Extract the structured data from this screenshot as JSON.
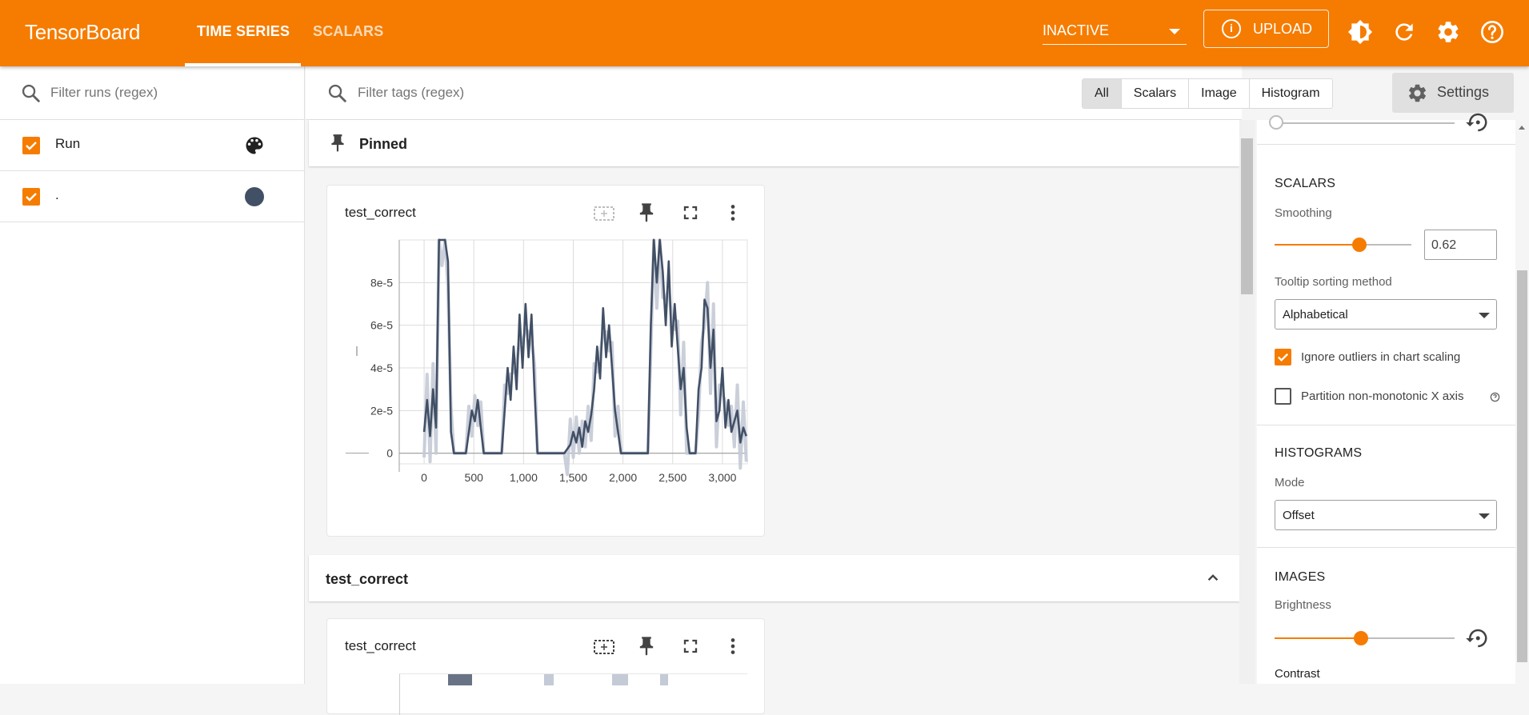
{
  "app": {
    "title": "TensorBoard",
    "nav_tabs": [
      "TIME SERIES",
      "SCALARS"
    ],
    "status": "INACTIVE",
    "upload_label": "UPLOAD",
    "brand_color": "#f57c00"
  },
  "runs": {
    "filter_placeholder": "Filter runs (regex)",
    "items": [
      {
        "name": "Run",
        "checked": true,
        "icon": "palette-icon"
      },
      {
        "name": ".",
        "checked": true,
        "color": "#425066"
      }
    ]
  },
  "main": {
    "tag_filter_placeholder": "Filter tags (regex)",
    "type_filters": [
      "All",
      "Scalars",
      "Image",
      "Histogram"
    ],
    "selected_filter": "All",
    "settings_label": "Settings",
    "pinned_label": "Pinned",
    "group_label": "test_correct",
    "cards": [
      {
        "title": "test_correct"
      },
      {
        "title": "test_correct"
      }
    ]
  },
  "settings": {
    "scalars_title": "SCALARS",
    "smoothing_label": "Smoothing",
    "smoothing_value": "0.62",
    "tooltip_label": "Tooltip sorting method",
    "tooltip_value": "Alphabetical",
    "ignore_outliers_label": "Ignore outliers in chart scaling",
    "ignore_outliers": true,
    "partition_label": "Partition non-monotonic X axis",
    "partition": false,
    "histograms_title": "HISTOGRAMS",
    "mode_label": "Mode",
    "mode_value": "Offset",
    "images_title": "IMAGES",
    "brightness_label": "Brightness",
    "contrast_label": "Contrast"
  },
  "chart_data": {
    "type": "line",
    "title": "test_correct",
    "y_tick_labels": [
      "0",
      "2e-5",
      "4e-5",
      "6e-5",
      "8e-5"
    ],
    "x_tick_labels": [
      "0",
      "500",
      "1,000",
      "1,500",
      "2,000",
      "2,500",
      "3,000"
    ],
    "xlim": [
      -250,
      3250
    ],
    "ylim": [
      -5e-06,
      0.0001
    ],
    "grid": true,
    "series": [
      {
        "smoothed_color": "#425066",
        "raw_color": "#c4cad6",
        "x": [
          0,
          30,
          60,
          90,
          120,
          150,
          180,
          210,
          240,
          270,
          300,
          330,
          360,
          390,
          420,
          450,
          480,
          510,
          540,
          570,
          600,
          630,
          660,
          690,
          720,
          750,
          780,
          810,
          840,
          870,
          900,
          930,
          960,
          990,
          1020,
          1050,
          1080,
          1110,
          1140,
          1170,
          1200,
          1230,
          1260,
          1290,
          1320,
          1350,
          1380,
          1410,
          1440,
          1470,
          1500,
          1530,
          1560,
          1590,
          1620,
          1650,
          1680,
          1710,
          1740,
          1770,
          1800,
          1830,
          1860,
          1890,
          1920,
          1950,
          1980,
          2010,
          2040,
          2070,
          2100,
          2130,
          2160,
          2190,
          2220,
          2250,
          2280,
          2310,
          2340,
          2370,
          2400,
          2430,
          2460,
          2490,
          2520,
          2550,
          2580,
          2610,
          2640,
          2670,
          2700,
          2730,
          2760,
          2790,
          2820,
          2850,
          2880,
          2910,
          2940,
          2970,
          3000,
          3030,
          3060,
          3090,
          3120,
          3150,
          3180,
          3210,
          3240
        ],
        "values": [
          1e-05,
          2.5e-05,
          8e-06,
          3e-05,
          1.2e-05,
          0.0001,
          0.0001,
          0.0001,
          9e-05,
          1e-05,
          0,
          0,
          0,
          0,
          0,
          1e-05,
          2e-05,
          1.5e-05,
          2.5e-05,
          1.2e-05,
          0,
          0,
          0,
          0,
          0,
          0,
          0,
          2e-05,
          4e-05,
          2.5e-05,
          5e-05,
          3e-05,
          6.5e-05,
          4e-05,
          7e-05,
          4.5e-05,
          6.5e-05,
          3e-05,
          0,
          0,
          0,
          0,
          0,
          0,
          0,
          0,
          0,
          0,
          2e-06,
          4e-06,
          1e-05,
          5e-06,
          1.2e-05,
          3e-06,
          1.5e-05,
          1e-05,
          1.8e-05,
          3e-05,
          5e-05,
          3.5e-05,
          6.8e-05,
          4.5e-05,
          6e-05,
          4e-05,
          2e-05,
          1e-05,
          0,
          0,
          0,
          0,
          0,
          0,
          0,
          0,
          0,
          0,
          6e-05,
          0.0001,
          8e-05,
          0.0001,
          8.5e-05,
          6e-05,
          9e-05,
          5e-05,
          7e-05,
          5e-05,
          3e-05,
          4e-05,
          1.2e-05,
          0,
          0,
          0,
          3e-05,
          4e-05,
          7.2e-05,
          6.8e-05,
          4e-05,
          5.8e-05,
          1.5e-05,
          2e-05,
          4e-05,
          1.2e-05,
          2.5e-05,
          1e-05,
          1.5e-05,
          2e-05,
          5e-06,
          1.2e-05,
          8e-06
        ]
      }
    ]
  }
}
